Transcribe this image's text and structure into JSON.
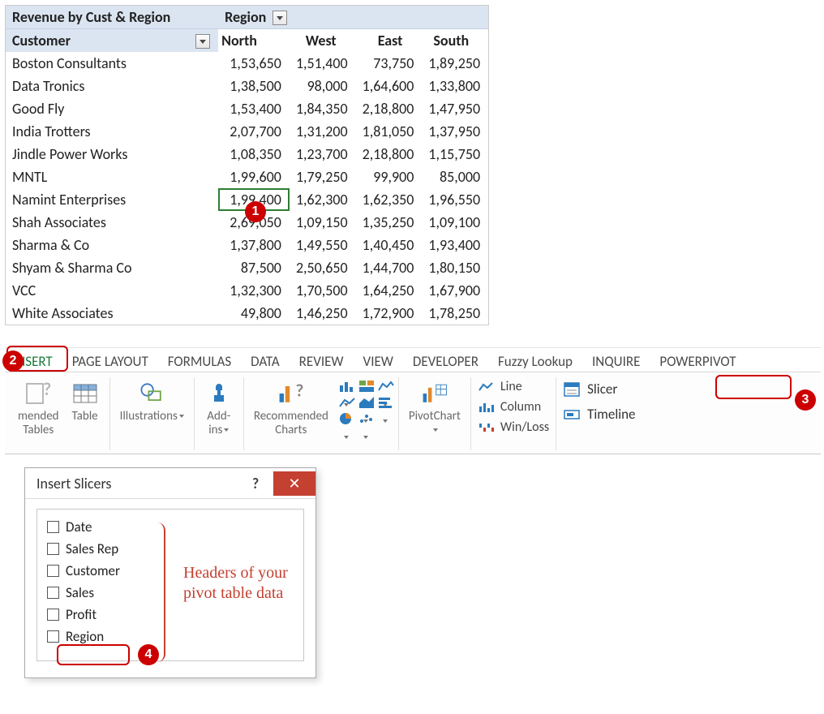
{
  "pivot": {
    "title": "Revenue by Cust & Region",
    "region_label": "Region",
    "row_field_label": "Customer",
    "columns": [
      "North",
      "West",
      "East",
      "South"
    ],
    "rows": [
      {
        "customer": "Boston Consultants",
        "values": [
          "1,53,650",
          "1,51,400",
          "73,750",
          "1,89,250"
        ]
      },
      {
        "customer": "Data Tronics",
        "values": [
          "1,38,500",
          "98,000",
          "1,64,600",
          "1,33,800"
        ]
      },
      {
        "customer": "Good Fly",
        "values": [
          "1,53,400",
          "1,84,350",
          "2,18,800",
          "1,47,950"
        ]
      },
      {
        "customer": "India Trotters",
        "values": [
          "2,07,700",
          "1,31,200",
          "1,81,050",
          "1,37,950"
        ]
      },
      {
        "customer": "Jindle Power Works",
        "values": [
          "1,08,350",
          "1,23,700",
          "2,18,800",
          "1,15,750"
        ]
      },
      {
        "customer": "MNTL",
        "values": [
          "1,99,600",
          "1,79,250",
          "99,900",
          "85,000"
        ]
      },
      {
        "customer": "Namint Enterprises",
        "values": [
          "1,99,400",
          "1,62,300",
          "1,62,350",
          "1,96,550"
        ]
      },
      {
        "customer": "Shah Associates",
        "values": [
          "2,69,050",
          "1,09,150",
          "1,35,250",
          "1,09,100"
        ]
      },
      {
        "customer": "Sharma & Co",
        "values": [
          "1,37,800",
          "1,49,550",
          "1,40,450",
          "1,93,400"
        ]
      },
      {
        "customer": "Shyam & Sharma Co",
        "values": [
          "87,500",
          "2,50,650",
          "1,44,700",
          "1,80,150"
        ]
      },
      {
        "customer": "VCC",
        "values": [
          "1,32,300",
          "1,70,500",
          "1,64,250",
          "1,67,900"
        ]
      },
      {
        "customer": "White Associates",
        "values": [
          "49,800",
          "1,46,250",
          "1,72,900",
          "1,78,250"
        ]
      }
    ],
    "selected_cell": {
      "row_index": 6,
      "col_index": 0
    }
  },
  "ribbon": {
    "tabs": [
      "INSERT",
      "PAGE LAYOUT",
      "FORMULAS",
      "DATA",
      "REVIEW",
      "VIEW",
      "DEVELOPER",
      "Fuzzy Lookup",
      "INQUIRE",
      "POWERPIVOT"
    ],
    "active_tab": "INSERT",
    "buttons": {
      "recommended_tables_top": "mended",
      "recommended_tables_bottom": "Tables",
      "table": "Table",
      "illustrations": "Illustrations",
      "addins": "Add-\nins",
      "recommended_charts": "Recommended\nCharts",
      "pivotchart": "PivotChart",
      "line": "Line",
      "column": "Column",
      "winloss": "Win/Loss",
      "slicer": "Slicer",
      "timeline": "Timeline"
    }
  },
  "dialog": {
    "title": "Insert Slicers",
    "fields": [
      "Date",
      "Sales Rep",
      "Customer",
      "Sales",
      "Profit",
      "Region"
    ]
  },
  "annotations": {
    "c1": "1",
    "c2": "2",
    "c3": "3",
    "c4": "4",
    "note": "Headers of your\npivot table data"
  }
}
